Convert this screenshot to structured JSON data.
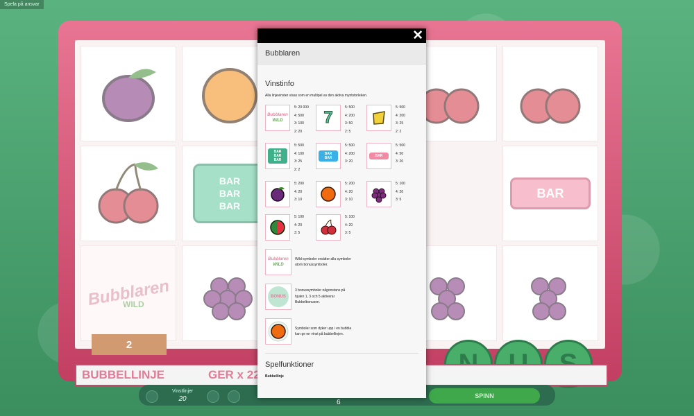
{
  "window": {
    "top_note": "Spela på ansvar"
  },
  "game": {
    "counter": "2",
    "bubbellinje": "BUBBELLINJE",
    "ger": "GER x 22",
    "vinst_label": "Vinstlinjer",
    "vinst_value": "20",
    "spinn": "SPINN",
    "page_num": "6",
    "bonus_letters": [
      "N",
      "U",
      "S"
    ],
    "reel_wild_text": "Bubblaren",
    "reel_wild_sub": "WILD",
    "bar_stack": [
      "BAR",
      "BAR",
      "BAR"
    ],
    "bar_single": "BAR"
  },
  "modal": {
    "close_label": "✕",
    "title": "Bubblaren",
    "vinstinfo_title": "Vinstinfo",
    "vinstinfo_intro": "Alla linjevinster visas som en multipel av den aktiva myntstorleken.",
    "symbols": [
      {
        "name": "wild",
        "pays": [
          "5: 20 000",
          "4: 500",
          "3: 100",
          "2: 20"
        ]
      },
      {
        "name": "seven",
        "pays": [
          "5: 500",
          "4: 200",
          "3: 50",
          "2: 5"
        ]
      },
      {
        "name": "bell",
        "pays": [
          "5: 500",
          "4: 200",
          "3: 25",
          "2: 2"
        ]
      },
      {
        "name": "bar-green",
        "pays": [
          "5: 500",
          "4: 100",
          "3: 25",
          "2: 2"
        ]
      },
      {
        "name": "bar-blue",
        "pays": [
          "5: 500",
          "4: 200",
          "3: 20"
        ]
      },
      {
        "name": "bar-pink",
        "pays": [
          "5: 500",
          "4: 50",
          "3: 20"
        ]
      },
      {
        "name": "plum",
        "pays": [
          "5: 200",
          "4: 20",
          "3: 10"
        ]
      },
      {
        "name": "orange",
        "pays": [
          "5: 200",
          "4: 20",
          "3: 10"
        ]
      },
      {
        "name": "grapes",
        "pays": [
          "5: 100",
          "4: 20",
          "3: 5"
        ]
      },
      {
        "name": "watermelon",
        "pays": [
          "5: 100",
          "4: 20",
          "3: 5"
        ]
      },
      {
        "name": "cherry",
        "pays": [
          "5: 100",
          "4: 20",
          "3: 5"
        ]
      }
    ],
    "wild_desc": "Wild-symboler ersätter alla symboler utom bonussymboler.",
    "bonus_desc": "3 bonussymboler någonstans på hjulen 1, 3 och 5 aktiverar Bubbelbonusen.",
    "bubble_desc": "Symboler som dyker upp i en bubbla kan ge en vinst på bubbellinjen.",
    "bonus_icon_text": "BONUS",
    "wild_icon_text": "Bubblaren",
    "wild_icon_sub": "WILD",
    "bar_label": "BAR",
    "seven_label": "7",
    "spelfunktioner_title": "Spelfunktioner",
    "bubbellinje_sub": "Bubbellinje"
  },
  "colors": {
    "modal_bg": "#f7f7f7",
    "accent_pink": "#e27d99",
    "bg_green": "#3f9a66"
  }
}
